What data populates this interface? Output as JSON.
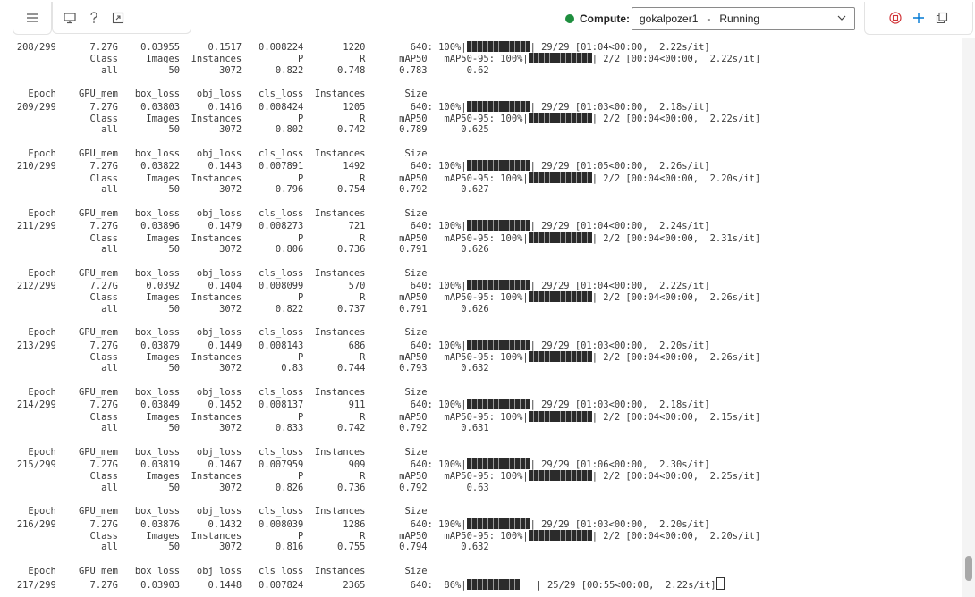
{
  "toolbar": {
    "icons": [
      "menu-icon",
      "monitor-icon",
      "help-icon",
      "expand-icon",
      "stop-icon",
      "add-icon",
      "popout-icon"
    ],
    "compute_label": "Compute:",
    "compute_name": "gokalpozer1",
    "compute_separator": "-",
    "compute_status": "Running",
    "status_color": "#1e8e3e",
    "accent_red": "#d13438",
    "accent_blue": "#0078d4"
  },
  "log": {
    "lines": [
      "   208/299      7.27G    0.03955     0.1517   0.008224       1220        640: 100%|",
      "                Class     Images  Instances          P          R      mAP50   mAP50-95: 100%|",
      "                  all         50       3072      0.822      0.748      0.783       0.62",
      "",
      "     Epoch    GPU_mem   box_loss   obj_loss   cls_loss  Instances       Size",
      "   209/299      7.27G    0.03803     0.1416   0.008424       1205        640: 100%|",
      "                Class     Images  Instances          P          R      mAP50   mAP50-95: 100%|",
      "                  all         50       3072      0.802      0.742      0.789      0.625",
      "",
      "     Epoch    GPU_mem   box_loss   obj_loss   cls_loss  Instances       Size",
      "   210/299      7.27G    0.03822     0.1443   0.007891       1492        640: 100%|",
      "                Class     Images  Instances          P          R      mAP50   mAP50-95: 100%|",
      "                  all         50       3072      0.796      0.754      0.792      0.627",
      "",
      "     Epoch    GPU_mem   box_loss   obj_loss   cls_loss  Instances       Size",
      "   211/299      7.27G    0.03896     0.1479   0.008273        721        640: 100%|",
      "                Class     Images  Instances          P          R      mAP50   mAP50-95: 100%|",
      "                  all         50       3072      0.806      0.736      0.791      0.626",
      "",
      "     Epoch    GPU_mem   box_loss   obj_loss   cls_loss  Instances       Size",
      "   212/299      7.27G     0.0392     0.1404   0.008099        570        640: 100%|",
      "                Class     Images  Instances          P          R      mAP50   mAP50-95: 100%|",
      "                  all         50       3072      0.822      0.737      0.791      0.626",
      "",
      "     Epoch    GPU_mem   box_loss   obj_loss   cls_loss  Instances       Size",
      "   213/299      7.27G    0.03879     0.1449   0.008143        686        640: 100%|",
      "                Class     Images  Instances          P          R      mAP50   mAP50-95: 100%|",
      "                  all         50       3072       0.83      0.744      0.793      0.632",
      "",
      "     Epoch    GPU_mem   box_loss   obj_loss   cls_loss  Instances       Size",
      "   214/299      7.27G    0.03849     0.1452   0.008137        911        640: 100%|",
      "                Class     Images  Instances          P          R      mAP50   mAP50-95: 100%|",
      "                  all         50       3072      0.833      0.742      0.792      0.631",
      "",
      "     Epoch    GPU_mem   box_loss   obj_loss   cls_loss  Instances       Size",
      "   215/299      7.27G    0.03819     0.1467   0.007959        909        640: 100%|",
      "                Class     Images  Instances          P          R      mAP50   mAP50-95: 100%|",
      "                  all         50       3072      0.826      0.736      0.792       0.63",
      "",
      "     Epoch    GPU_mem   box_loss   obj_loss   cls_loss  Instances       Size",
      "   216/299      7.27G    0.03876     0.1432   0.008039       1286        640: 100%|",
      "                Class     Images  Instances          P          R      mAP50   mAP50-95: 100%|",
      "                  all         50       3072      0.816      0.755      0.794      0.632",
      "",
      "     Epoch    GPU_mem   box_loss   obj_loss   cls_loss  Instances       Size",
      "   217/299      7.27G    0.03903     0.1448   0.007824       2365        640:  86%|"
    ],
    "bar_suffixes": {
      "0": "| 29/29 [01:04<00:00,  2.22s/it]",
      "1": "| 2/2 [00:04<00:00,  2.22s/it]",
      "5": "| 29/29 [01:03<00:00,  2.18s/it]",
      "6": "| 2/2 [00:04<00:00,  2.22s/it]",
      "10": "| 29/29 [01:05<00:00,  2.26s/it]",
      "11": "| 2/2 [00:04<00:00,  2.20s/it]",
      "15": "| 29/29 [01:04<00:00,  2.24s/it]",
      "16": "| 2/2 [00:04<00:00,  2.31s/it]",
      "20": "| 29/29 [01:04<00:00,  2.22s/it]",
      "21": "| 2/2 [00:04<00:00,  2.26s/it]",
      "25": "| 29/29 [01:03<00:00,  2.20s/it]",
      "26": "| 2/2 [00:04<00:00,  2.26s/it]",
      "30": "| 29/29 [01:03<00:00,  2.18s/it]",
      "31": "| 2/2 [00:04<00:00,  2.15s/it]",
      "35": "| 29/29 [01:06<00:00,  2.30s/it]",
      "36": "| 2/2 [00:04<00:00,  2.25s/it]",
      "40": "| 29/29 [01:03<00:00,  2.20s/it]",
      "41": "| 2/2 [00:04<00:00,  2.20s/it]",
      "45": "   | 25/29 [00:55<00:08,  2.22s/it]"
    },
    "partial_bar_line": 45,
    "progress_fractions": {
      "45": 0.86
    }
  }
}
